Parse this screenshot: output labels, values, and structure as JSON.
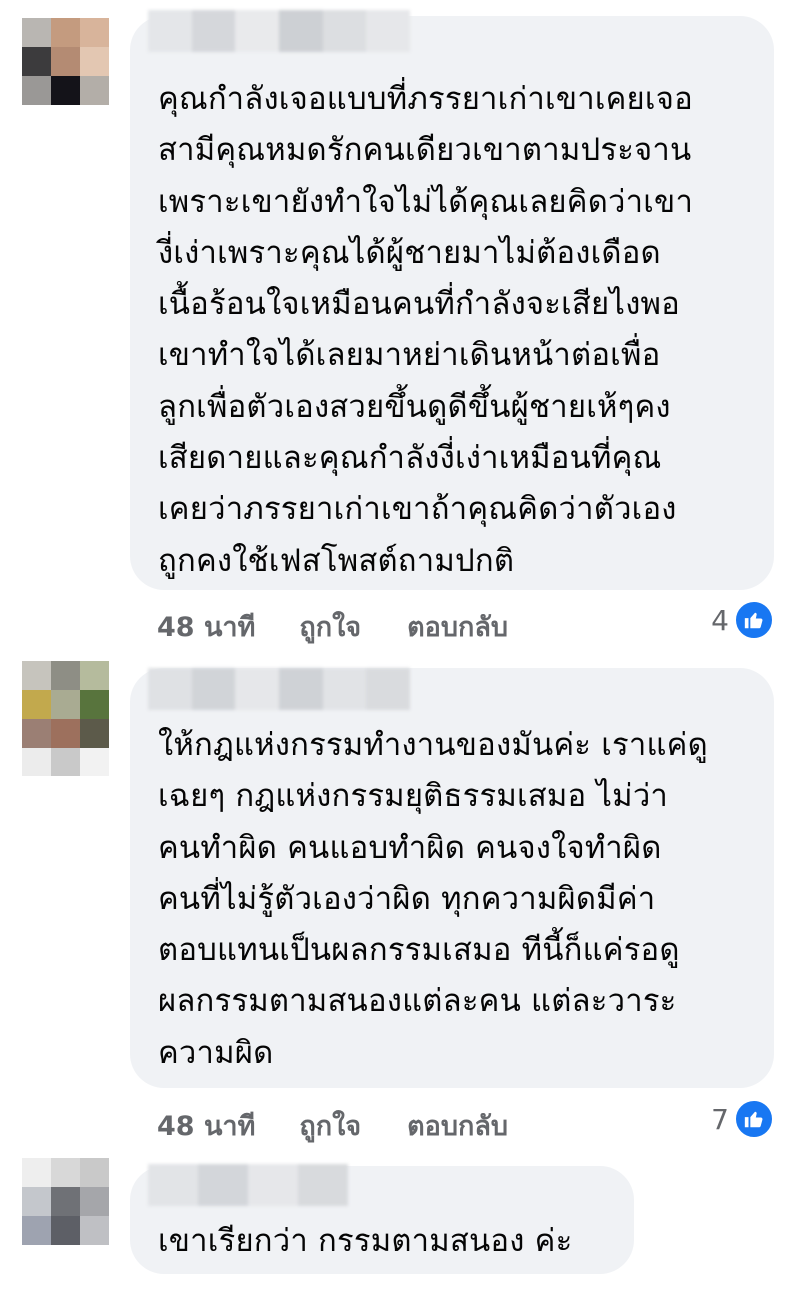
{
  "colors": {
    "bubble": "#f0f2f5",
    "meta_text": "#65676b",
    "like_blue": "#1877f2"
  },
  "comments": [
    {
      "text": "คุณกำลังเจอแบบที่ภรรยาเก่าเขาเคยเจอ\nสามีคุณหมดรักคนเดียวเขาตามประจาน\nเพราะเขายังทำใจไม่ได้คุณเลยคิดว่าเขา\nงี่เง่าเพราะคุณได้ผู้ชายมาไม่ต้องเดือด\nเนื้อร้อนใจเหมือนคนที่กำลังจะเสียไงพอ\nเขาทำใจได้เลยมาหย่าเดินหน้าต่อเพื่อ\nลูกเพื่อตัวเองสวยขึ้นดูดีขึ้นผู้ชายเห้ๆคง\nเสียดายและคุณกำลังงี่เง่าเหมือนที่คุณ\nเคยว่าภรรยาเก่าเขาถ้าคุณคิดว่าตัวเอง\nถูกคงใช้เฟสโพสต์ถามปกติ",
      "time": "48 นาที",
      "like_label": "ถูกใจ",
      "reply_label": "ตอบกลับ",
      "reaction_count": "4",
      "reaction_icon": "like-icon"
    },
    {
      "text": "ให้กฎแห่งกรรมทำงานของมันค่ะ เราแค่ดู\nเฉยๆ กฎแห่งกรรมยุติธรรมเสมอ ไม่ว่า\nคนทำผิด คนแอบทำผิด คนจงใจทำผิด\nคนที่ไม่รู้ตัวเองว่าผิด ทุกความผิดมีค่า\nตอบแทนเป็นผลกรรมเสมอ ทีนี้ก็แค่รอดู\nผลกรรมตามสนองแต่ละคน แต่ละวาระ\nความผิด",
      "time": "48 นาที",
      "like_label": "ถูกใจ",
      "reply_label": "ตอบกลับ",
      "reaction_count": "7",
      "reaction_icon": "like-icon"
    },
    {
      "text": "เขาเรียกว่า กรรมตามสนอง ค่ะ"
    }
  ]
}
